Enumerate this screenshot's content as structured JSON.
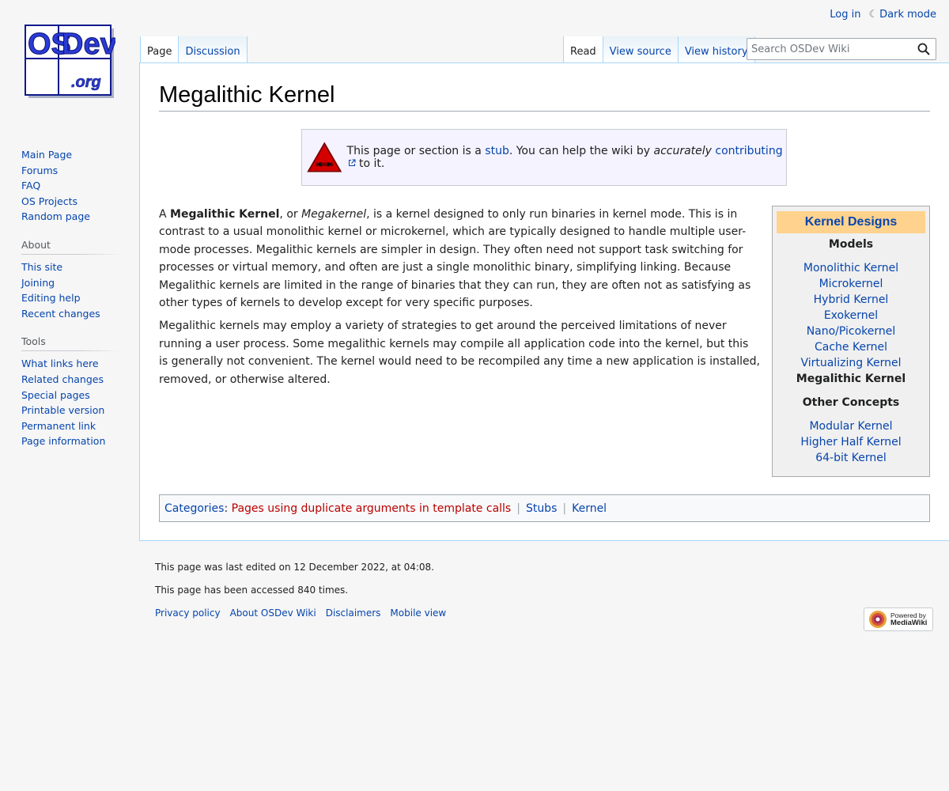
{
  "personal": {
    "login": "Log in",
    "dark_mode": "Dark mode"
  },
  "logo": {
    "line1": "OS",
    "line2": "Dev",
    "line3": ".org"
  },
  "sidebar": {
    "navigation": [
      "Main Page",
      "Forums",
      "FAQ",
      "OS Projects",
      "Random page"
    ],
    "about": {
      "heading": "About",
      "items": [
        "This site",
        "Joining",
        "Editing help",
        "Recent changes"
      ]
    },
    "tools": {
      "heading": "Tools",
      "items": [
        "What links here",
        "Related changes",
        "Special pages",
        "Printable version",
        "Permanent link",
        "Page information"
      ]
    }
  },
  "tabs": {
    "left": [
      "Page",
      "Discussion"
    ],
    "right": [
      "Read",
      "View source",
      "View history"
    ]
  },
  "search": {
    "placeholder": "Search OSDev Wiki"
  },
  "page": {
    "title": "Megalithic Kernel",
    "stub": {
      "t1": "This page or section is a ",
      "link_stub": "stub",
      "t2": ". You can help the wiki by ",
      "emph": "accurately",
      "link_contrib": "contributing",
      "t3": " to it."
    },
    "p1": {
      "a": "A ",
      "bold": "Megalithic Kernel",
      "b": ", or ",
      "italic": "Megakernel",
      "c": ", is a kernel designed to only run binaries in kernel mode. This is in contrast to a usual monolithic kernel or microkernel, which are typically designed to handle multiple user-mode processes. Megalithic kernels are simpler in design. They often need not support task switching for processes or virtual memory, and often are just a single monolithic binary, simplifying linking. Because Megalithic kernels are limited in the range of binaries that they can run, they are often not as satisfying as other types of kernels to develop except for very specific purposes."
    },
    "p2": "Megalithic kernels may employ a variety of strategies to get around the perceived limitations of never running a user process. Some megalithic kernels may compile all application code into the kernel, but this is generally not convenient. The kernel would need to be recompiled any time a new application is installed, removed, or otherwise altered."
  },
  "infobox": {
    "title": "Kernel Designs",
    "models_heading": "Models",
    "models": [
      "Monolithic Kernel",
      "Microkernel",
      "Hybrid Kernel",
      "Exokernel",
      "Nano/Picokernel",
      "Cache Kernel",
      "Virtualizing Kernel"
    ],
    "current": "Megalithic Kernel",
    "other_heading": "Other Concepts",
    "other": [
      "Modular Kernel",
      "Higher Half Kernel",
      "64-bit Kernel"
    ]
  },
  "categories": {
    "label": "Categories",
    "colon": ":",
    "items": [
      "Pages using duplicate arguments in template calls",
      "Stubs",
      "Kernel"
    ]
  },
  "footer": {
    "last_edited": "This page was last edited on 12 December 2022, at 04:08.",
    "accessed": "This page has been accessed 840 times.",
    "links": [
      "Privacy policy",
      "About OSDev Wiki",
      "Disclaimers",
      "Mobile view"
    ],
    "powered_by": {
      "line1": "Powered by",
      "line2": "MediaWiki"
    }
  },
  "colors": {
    "link": "#0645ad",
    "redlink": "#ba0000",
    "infobox_title_bg": "#ffd38d",
    "stub_bg": "#f5f3ff"
  }
}
